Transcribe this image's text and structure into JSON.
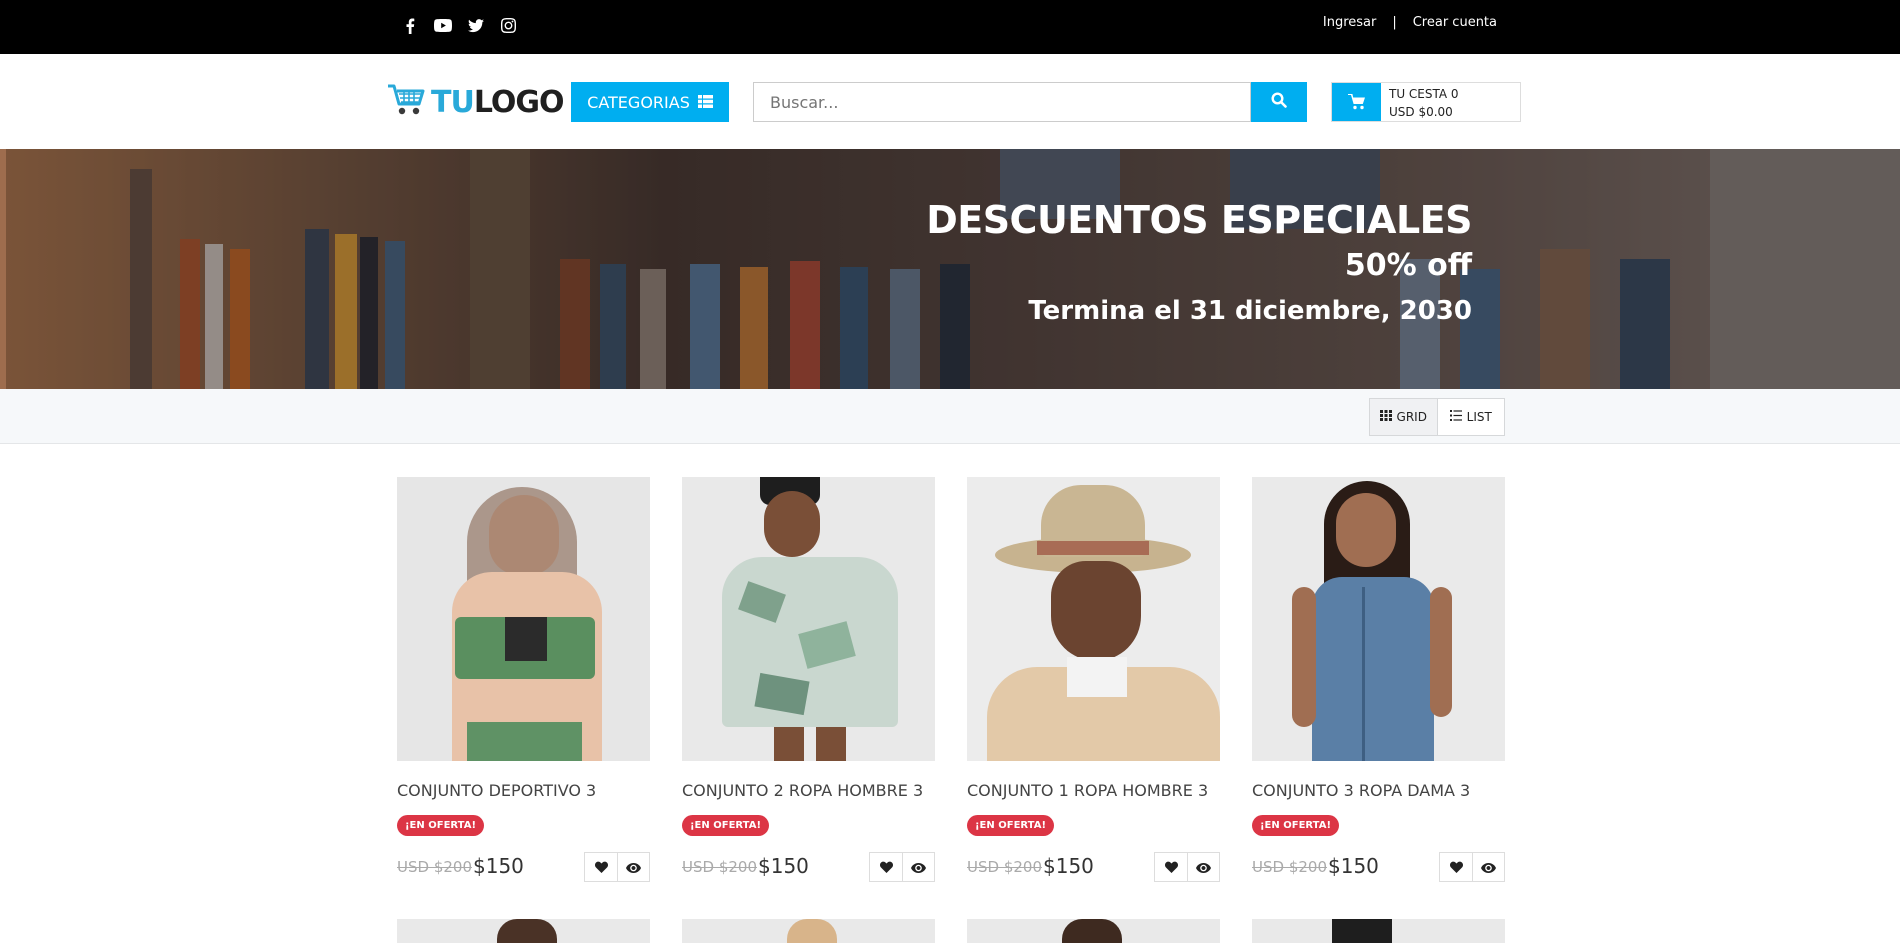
{
  "topbar": {
    "social": [
      "facebook-icon",
      "youtube-icon",
      "twitter-icon",
      "instagram-icon"
    ],
    "login": "Ingresar",
    "separator": "|",
    "register": "Crear cuenta"
  },
  "header": {
    "logo_tu": "TU",
    "logo_rest": "LOGO",
    "categories_label": "CATEGORIAS",
    "search_placeholder": "Buscar...",
    "cart_line1": "TU CESTA 0",
    "cart_line2": "USD $0.00"
  },
  "banner": {
    "title": "DESCUENTOS ESPECIALES",
    "discount": "50% off",
    "ends": "Termina el 31 diciembre, 2030"
  },
  "view": {
    "grid_label": "GRID",
    "list_label": "LIST",
    "active": "grid"
  },
  "products": [
    {
      "name": "CONJUNTO DEPORTIVO 3",
      "badge": "¡EN OFERTA!",
      "old_price": "USD $200",
      "price": "$150"
    },
    {
      "name": "CONJUNTO 2 ROPA HOMBRE 3",
      "badge": "¡EN OFERTA!",
      "old_price": "USD $200",
      "price": "$150"
    },
    {
      "name": "CONJUNTO 1 ROPA HOMBRE 3",
      "badge": "¡EN OFERTA!",
      "old_price": "USD $200",
      "price": "$150"
    },
    {
      "name": "CONJUNTO 3 ROPA DAMA 3",
      "badge": "¡EN OFERTA!",
      "old_price": "USD $200",
      "price": "$150"
    }
  ],
  "colors": {
    "accent": "#00aef0",
    "topbar": "#000000",
    "badge": "#dc3545",
    "logo_tu": "#29a9d9"
  }
}
